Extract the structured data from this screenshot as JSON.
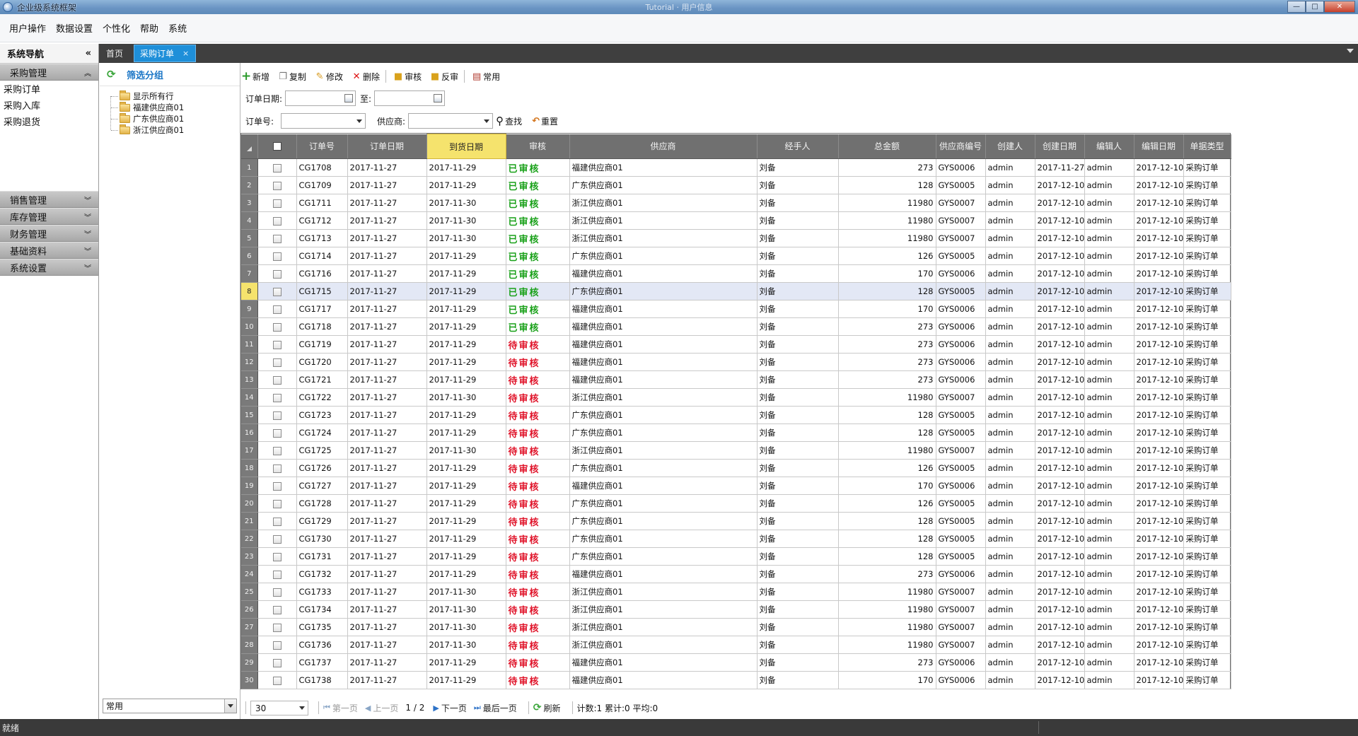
{
  "window": {
    "title": "企业级系统框架",
    "center_title": "Tutorial · 用户信息",
    "btn_min": "—",
    "btn_max": "□",
    "btn_close": "✕"
  },
  "menu": [
    "用户操作",
    "数据设置",
    "个性化",
    "帮助",
    "系统"
  ],
  "tabs": {
    "home": "首页",
    "active": "采购订单",
    "close": "×"
  },
  "nav": {
    "title": "系统导航",
    "collapse": "«",
    "open_section": "采购管理",
    "open_items": [
      "采购订单",
      "采购入库",
      "采购退货"
    ],
    "sections": [
      "销售管理",
      "库存管理",
      "财务管理",
      "基础资料",
      "系统设置"
    ]
  },
  "group": {
    "title": "筛选分组",
    "tree": [
      "显示所有行",
      "福建供应商01",
      "广东供应商01",
      "浙江供应商01"
    ],
    "select_value": "常用"
  },
  "toolbar": {
    "add": "新增",
    "copy": "复制",
    "edit": "修改",
    "delete": "删除",
    "approve": "审核",
    "unapprove": "反审",
    "common": "常用"
  },
  "search": {
    "order_date_label": "订单日期:",
    "to_label": "至:",
    "order_no_label": "订单号:",
    "supplier_label": "供应商:",
    "search_btn": "查找",
    "reset_btn": "重置"
  },
  "columns": [
    "订单号",
    "订单日期",
    "到货日期",
    "审核",
    "供应商",
    "经手人",
    "总金额",
    "供应商编号",
    "创建人",
    "创建日期",
    "编辑人",
    "编辑日期",
    "单据类型"
  ],
  "selected_row": 8,
  "rows": [
    [
      "CG1708",
      "2017-11-27",
      "2017-11-29",
      "已审核",
      "福建供应商01",
      "刘备",
      "273",
      "GYS0006",
      "admin",
      "2017-11-27",
      "admin",
      "2017-12-10",
      "采购订单"
    ],
    [
      "CG1709",
      "2017-11-27",
      "2017-11-29",
      "已审核",
      "广东供应商01",
      "刘备",
      "128",
      "GYS0005",
      "admin",
      "2017-12-10",
      "admin",
      "2017-12-10",
      "采购订单"
    ],
    [
      "CG1711",
      "2017-11-27",
      "2017-11-30",
      "已审核",
      "浙江供应商01",
      "刘备",
      "11980",
      "GYS0007",
      "admin",
      "2017-12-10",
      "admin",
      "2017-12-10",
      "采购订单"
    ],
    [
      "CG1712",
      "2017-11-27",
      "2017-11-30",
      "已审核",
      "浙江供应商01",
      "刘备",
      "11980",
      "GYS0007",
      "admin",
      "2017-12-10",
      "admin",
      "2017-12-10",
      "采购订单"
    ],
    [
      "CG1713",
      "2017-11-27",
      "2017-11-30",
      "已审核",
      "浙江供应商01",
      "刘备",
      "11980",
      "GYS0007",
      "admin",
      "2017-12-10",
      "admin",
      "2017-12-10",
      "采购订单"
    ],
    [
      "CG1714",
      "2017-11-27",
      "2017-11-29",
      "已审核",
      "广东供应商01",
      "刘备",
      "126",
      "GYS0005",
      "admin",
      "2017-12-10",
      "admin",
      "2017-12-10",
      "采购订单"
    ],
    [
      "CG1716",
      "2017-11-27",
      "2017-11-29",
      "已审核",
      "福建供应商01",
      "刘备",
      "170",
      "GYS0006",
      "admin",
      "2017-12-10",
      "admin",
      "2017-12-10",
      "采购订单"
    ],
    [
      "CG1715",
      "2017-11-27",
      "2017-11-29",
      "已审核",
      "广东供应商01",
      "刘备",
      "128",
      "GYS0005",
      "admin",
      "2017-12-10",
      "admin",
      "2017-12-10",
      "采购订单"
    ],
    [
      "CG1717",
      "2017-11-27",
      "2017-11-29",
      "已审核",
      "福建供应商01",
      "刘备",
      "170",
      "GYS0006",
      "admin",
      "2017-12-10",
      "admin",
      "2017-12-10",
      "采购订单"
    ],
    [
      "CG1718",
      "2017-11-27",
      "2017-11-29",
      "已审核",
      "福建供应商01",
      "刘备",
      "273",
      "GYS0006",
      "admin",
      "2017-12-10",
      "admin",
      "2017-12-10",
      "采购订单"
    ],
    [
      "CG1719",
      "2017-11-27",
      "2017-11-29",
      "待审核",
      "福建供应商01",
      "刘备",
      "273",
      "GYS0006",
      "admin",
      "2017-12-10",
      "admin",
      "2017-12-10",
      "采购订单"
    ],
    [
      "CG1720",
      "2017-11-27",
      "2017-11-29",
      "待审核",
      "福建供应商01",
      "刘备",
      "273",
      "GYS0006",
      "admin",
      "2017-12-10",
      "admin",
      "2017-12-10",
      "采购订单"
    ],
    [
      "CG1721",
      "2017-11-27",
      "2017-11-29",
      "待审核",
      "福建供应商01",
      "刘备",
      "273",
      "GYS0006",
      "admin",
      "2017-12-10",
      "admin",
      "2017-12-10",
      "采购订单"
    ],
    [
      "CG1722",
      "2017-11-27",
      "2017-11-30",
      "待审核",
      "浙江供应商01",
      "刘备",
      "11980",
      "GYS0007",
      "admin",
      "2017-12-10",
      "admin",
      "2017-12-10",
      "采购订单"
    ],
    [
      "CG1723",
      "2017-11-27",
      "2017-11-29",
      "待审核",
      "广东供应商01",
      "刘备",
      "128",
      "GYS0005",
      "admin",
      "2017-12-10",
      "admin",
      "2017-12-10",
      "采购订单"
    ],
    [
      "CG1724",
      "2017-11-27",
      "2017-11-29",
      "待审核",
      "广东供应商01",
      "刘备",
      "128",
      "GYS0005",
      "admin",
      "2017-12-10",
      "admin",
      "2017-12-10",
      "采购订单"
    ],
    [
      "CG1725",
      "2017-11-27",
      "2017-11-30",
      "待审核",
      "浙江供应商01",
      "刘备",
      "11980",
      "GYS0007",
      "admin",
      "2017-12-10",
      "admin",
      "2017-12-10",
      "采购订单"
    ],
    [
      "CG1726",
      "2017-11-27",
      "2017-11-29",
      "待审核",
      "广东供应商01",
      "刘备",
      "126",
      "GYS0005",
      "admin",
      "2017-12-10",
      "admin",
      "2017-12-10",
      "采购订单"
    ],
    [
      "CG1727",
      "2017-11-27",
      "2017-11-29",
      "待审核",
      "福建供应商01",
      "刘备",
      "170",
      "GYS0006",
      "admin",
      "2017-12-10",
      "admin",
      "2017-12-10",
      "采购订单"
    ],
    [
      "CG1728",
      "2017-11-27",
      "2017-11-29",
      "待审核",
      "广东供应商01",
      "刘备",
      "126",
      "GYS0005",
      "admin",
      "2017-12-10",
      "admin",
      "2017-12-10",
      "采购订单"
    ],
    [
      "CG1729",
      "2017-11-27",
      "2017-11-29",
      "待审核",
      "广东供应商01",
      "刘备",
      "128",
      "GYS0005",
      "admin",
      "2017-12-10",
      "admin",
      "2017-12-10",
      "采购订单"
    ],
    [
      "CG1730",
      "2017-11-27",
      "2017-11-29",
      "待审核",
      "广东供应商01",
      "刘备",
      "128",
      "GYS0005",
      "admin",
      "2017-12-10",
      "admin",
      "2017-12-10",
      "采购订单"
    ],
    [
      "CG1731",
      "2017-11-27",
      "2017-11-29",
      "待审核",
      "广东供应商01",
      "刘备",
      "128",
      "GYS0005",
      "admin",
      "2017-12-10",
      "admin",
      "2017-12-10",
      "采购订单"
    ],
    [
      "CG1732",
      "2017-11-27",
      "2017-11-29",
      "待审核",
      "福建供应商01",
      "刘备",
      "273",
      "GYS0006",
      "admin",
      "2017-12-10",
      "admin",
      "2017-12-10",
      "采购订单"
    ],
    [
      "CG1733",
      "2017-11-27",
      "2017-11-30",
      "待审核",
      "浙江供应商01",
      "刘备",
      "11980",
      "GYS0007",
      "admin",
      "2017-12-10",
      "admin",
      "2017-12-10",
      "采购订单"
    ],
    [
      "CG1734",
      "2017-11-27",
      "2017-11-30",
      "待审核",
      "浙江供应商01",
      "刘备",
      "11980",
      "GYS0007",
      "admin",
      "2017-12-10",
      "admin",
      "2017-12-10",
      "采购订单"
    ],
    [
      "CG1735",
      "2017-11-27",
      "2017-11-30",
      "待审核",
      "浙江供应商01",
      "刘备",
      "11980",
      "GYS0007",
      "admin",
      "2017-12-10",
      "admin",
      "2017-12-10",
      "采购订单"
    ],
    [
      "CG1736",
      "2017-11-27",
      "2017-11-30",
      "待审核",
      "浙江供应商01",
      "刘备",
      "11980",
      "GYS0007",
      "admin",
      "2017-12-10",
      "admin",
      "2017-12-10",
      "采购订单"
    ],
    [
      "CG1737",
      "2017-11-27",
      "2017-11-29",
      "待审核",
      "福建供应商01",
      "刘备",
      "273",
      "GYS0006",
      "admin",
      "2017-12-10",
      "admin",
      "2017-12-10",
      "采购订单"
    ],
    [
      "CG1738",
      "2017-11-27",
      "2017-11-29",
      "待审核",
      "福建供应商01",
      "刘备",
      "170",
      "GYS0006",
      "admin",
      "2017-12-10",
      "admin",
      "2017-12-10",
      "采购订单"
    ]
  ],
  "pager": {
    "page_size": "30",
    "first": "第一页",
    "prev": "上一页",
    "page_info": "1 / 2",
    "next": "下一页",
    "last": "最后一页",
    "refresh": "刷新",
    "stats": "计数:1 累计:0 平均:0"
  },
  "status": "就绪",
  "colors": {
    "accent_tab": "#1e8fd9",
    "approved": "#1aa11a",
    "pending": "#e0142a",
    "sorted_header": "#f5e36d"
  }
}
